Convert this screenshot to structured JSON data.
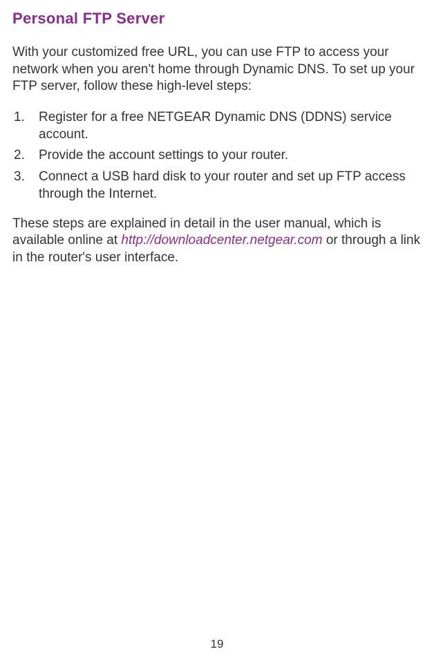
{
  "heading": "Personal FTP Server",
  "intro": "With your customized free URL, you can use FTP to access your network when you aren't home through Dynamic DNS. To set up your FTP server, follow these high-level steps:",
  "steps": [
    "Register for a free NETGEAR Dynamic DNS (DDNS) service account.",
    "Provide the account settings to your router.",
    "Connect a USB hard disk to your router and set up FTP access through the Internet."
  ],
  "outro_before": "These steps are explained in detail in the user manual, which is available online at ",
  "outro_link": "http://downloadcenter.netgear.com",
  "outro_after": " or through a link in the router's user interface.",
  "page_number": "19"
}
